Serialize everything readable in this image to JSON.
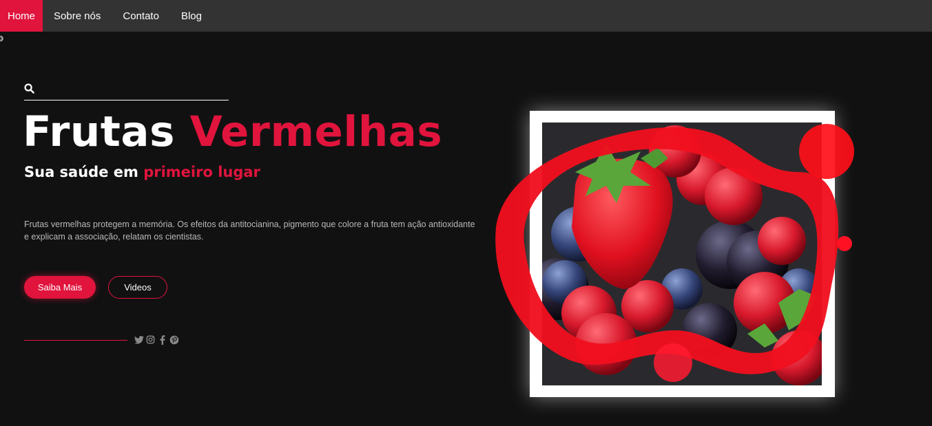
{
  "nav": {
    "items": [
      {
        "label": "Home"
      },
      {
        "label": "Sobre nós"
      },
      {
        "label": "Contato"
      },
      {
        "label": "Blog"
      }
    ]
  },
  "hero": {
    "title_part1": "Frutas",
    "title_part2": "Vermelhas",
    "subtitle_part1": "Sua saúde em",
    "subtitle_part2": "primeiro lugar",
    "description": "Frutas vermelhas protegem a memória. Os efeitos da antitocianina, pigmento que colore a fruta tem ação antioxidante e explicam a associação, relatam os cientistas.",
    "primary_button": "Saiba Mais",
    "secondary_button": "Videos"
  },
  "social": [
    "twitter-icon",
    "instagram-icon",
    "facebook-icon",
    "pinterest-icon"
  ],
  "colors": {
    "accent": "#e0143c",
    "background": "#111112",
    "nav": "#333333"
  }
}
